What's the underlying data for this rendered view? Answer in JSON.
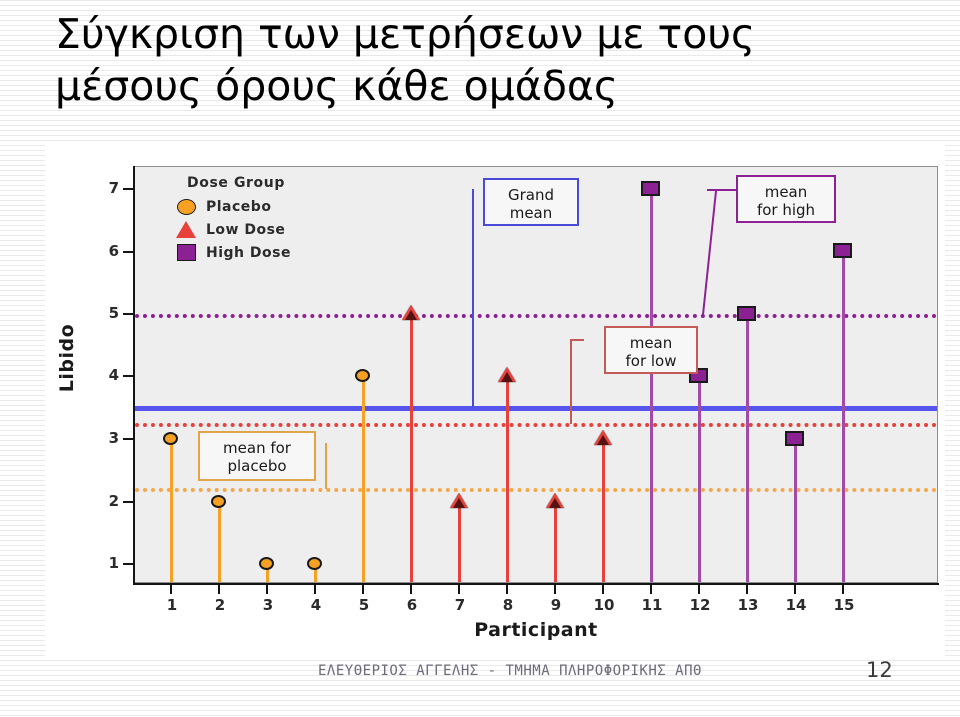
{
  "slide": {
    "title": "Σύγκριση των μετρήσεων με τους\nμέσους όρους κάθε ομάδας",
    "footer": "ΕΛΕΥΘΕΡΙΟΣ ΑΓΓΕΛΗΣ - ΤΜΗΜΑ ΠΛΗΡΟΦΟΡΙΚΗΣ ΑΠΘ",
    "page_number": "12"
  },
  "colors": {
    "placebo": "#f6a024",
    "low_dose": "#e8413c",
    "high_dose": "#8c2193",
    "grand_mean": "#5555ee",
    "plot_background": "#efeeef",
    "axis": "#141414"
  },
  "legend": {
    "title": "Dose Group",
    "items": [
      {
        "label": "Placebo",
        "marker": "circle-marker",
        "color": "#f6a024"
      },
      {
        "label": "Low Dose",
        "marker": "triangle-marker",
        "color": "#e8413c"
      },
      {
        "label": "High Dose",
        "marker": "square-marker",
        "color": "#8c2193"
      }
    ]
  },
  "callouts": [
    {
      "id": "grand-mean",
      "text": "Grand\nmean",
      "color": "#4a4ad8"
    },
    {
      "id": "mean-high",
      "text": "mean\nfor high",
      "color": "#8c2193"
    },
    {
      "id": "mean-low",
      "text": "mean\nfor low",
      "color": "#c25a55"
    },
    {
      "id": "mean-placebo",
      "text": "mean for\nplacebo",
      "color": "#e0a44a"
    }
  ],
  "chart_data": {
    "type": "scatter",
    "title": "",
    "xlabel": "Participant",
    "ylabel": "Libido",
    "xlim": [
      0.5,
      15.5
    ],
    "ylim": [
      0.4,
      7.45
    ],
    "yticks": [
      1,
      2,
      3,
      4,
      5,
      6,
      7
    ],
    "xticks": [
      1,
      2,
      3,
      4,
      5,
      6,
      7,
      8,
      9,
      10,
      11,
      12,
      13,
      14,
      15
    ],
    "grid": false,
    "legend_position": "top-left-inside",
    "series": [
      {
        "name": "Placebo",
        "marker": "circle",
        "color": "#f6a024",
        "x": [
          1,
          2,
          3,
          4,
          5
        ],
        "values": [
          3,
          2,
          1,
          1,
          4
        ]
      },
      {
        "name": "Low Dose",
        "marker": "triangle",
        "color": "#e8413c",
        "x": [
          6,
          7,
          8,
          9,
          10
        ],
        "values": [
          5,
          2,
          4,
          2,
          3
        ]
      },
      {
        "name": "High Dose",
        "marker": "square",
        "color": "#8c2193",
        "x": [
          11,
          12,
          13,
          14,
          15
        ],
        "values": [
          7,
          4,
          5,
          3,
          6
        ]
      }
    ],
    "reference_lines": [
      {
        "name": "mean for high",
        "value": 5.0,
        "color": "#8c2193",
        "style": "dotted"
      },
      {
        "name": "grand mean",
        "value": 3.47,
        "color": "#5555ee",
        "style": "solid"
      },
      {
        "name": "mean for low",
        "value": 3.2,
        "color": "#e8413c",
        "style": "dotted"
      },
      {
        "name": "mean for placebo",
        "value": 2.2,
        "color": "#f5a84a",
        "style": "dotted"
      }
    ]
  }
}
